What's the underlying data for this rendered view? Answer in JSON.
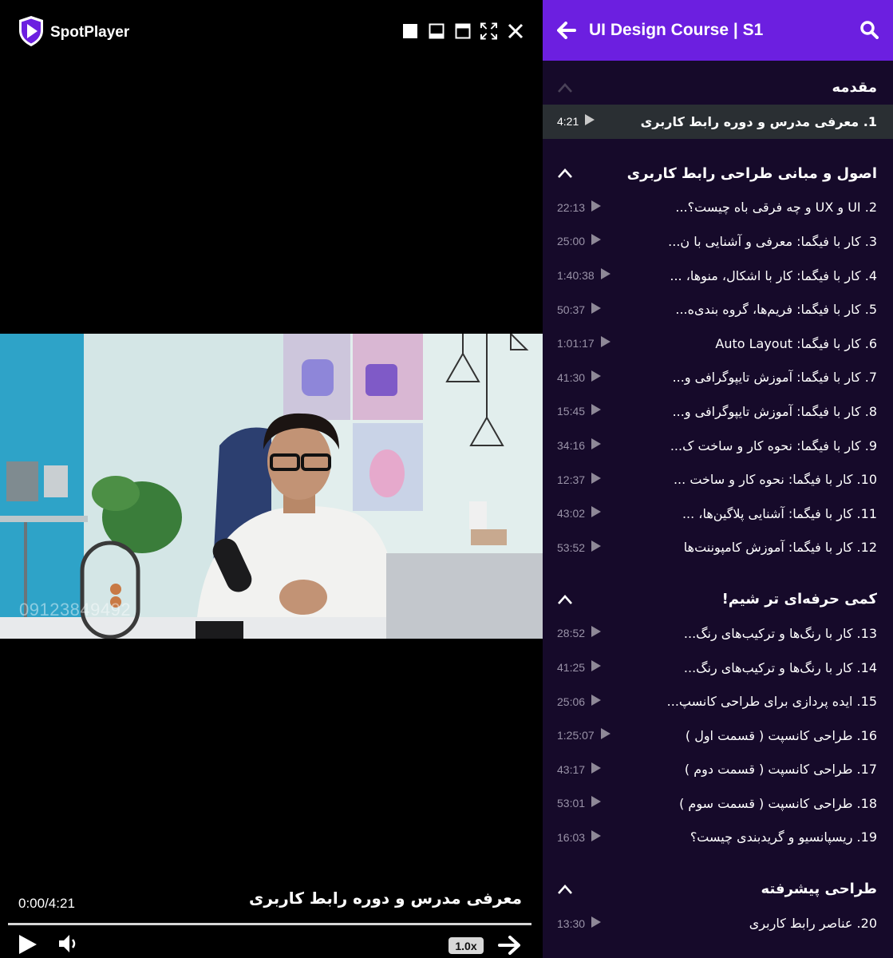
{
  "app": {
    "brand": "SpotPlayer",
    "window_controls": [
      "square-icon",
      "minimize-panel-icon",
      "maximize-icon",
      "fullscreen-icon",
      "close-icon"
    ]
  },
  "video": {
    "watermark": "09123849492",
    "time": "0:00/4:21",
    "title": "معرفی مدرس و دوره رابط کاربری",
    "progress": 0,
    "speed": "1.0x"
  },
  "playlist": {
    "title": "UI Design Course | S1",
    "accent": "#6c1fe0",
    "sections": [
      {
        "title": "مقدمه",
        "expanded": true,
        "lessons": [
          {
            "title": "1. معرفی مدرس و دوره رابط کاربری",
            "duration": "4:21",
            "active": true
          }
        ]
      },
      {
        "title": "اصول و مبانی طراحی رابط کاربری",
        "expanded": true,
        "lessons": [
          {
            "title": "2. UI و UX و چه فرقی باه چیست؟...",
            "duration": "22:13"
          },
          {
            "title": "3. کار با فیگما: معرفی و آشنایی با ن...",
            "duration": "25:00"
          },
          {
            "title": "4. کار با فیگما: کار با اشکال، منوها، ...",
            "duration": "1:40:38"
          },
          {
            "title": "5. کار با فیگما: فریم‌ها، گروه بندی‌ه...",
            "duration": "50:37"
          },
          {
            "title": "6. کار با فیگما: Auto Layout",
            "duration": "1:01:17"
          },
          {
            "title": "7. کار با فیگما: آموزش تایپوگرافی و...",
            "duration": "41:30"
          },
          {
            "title": "8. کار با فیگما: آموزش تایپوگرافی و...",
            "duration": "15:45"
          },
          {
            "title": "9. کار با فیگما: نحوه کار و ساخت ک...",
            "duration": "34:16"
          },
          {
            "title": "10. کار با فیگما: نحوه کار و ساخت ...",
            "duration": "12:37"
          },
          {
            "title": "11. کار با فیگما: آشنایی پلاگین‌ها، ...",
            "duration": "43:02"
          },
          {
            "title": "12. کار با فیگما: آموزش کامپوننت‌ها",
            "duration": "53:52"
          }
        ]
      },
      {
        "title": "کمی حرفه‌ای تر شیم!",
        "expanded": true,
        "lessons": [
          {
            "title": "13. کار با رنگ‌ها و ترکیب‌های رنگ...",
            "duration": "28:52"
          },
          {
            "title": "14. کار با رنگ‌ها و ترکیب‌های رنگ...",
            "duration": "41:25"
          },
          {
            "title": "15. ایده پردازی برای طراحی کانسپ...",
            "duration": "25:06"
          },
          {
            "title": "16. طراحی کانسپت ( قسمت اول )",
            "duration": "1:25:07"
          },
          {
            "title": "17. طراحی کانسپت ( قسمت دوم )",
            "duration": "43:17"
          },
          {
            "title": "18. طراحی کانسپت ( قسمت سوم )",
            "duration": "53:01"
          },
          {
            "title": "19. ریسپانسیو و گریدبندی چیست؟",
            "duration": "16:03"
          }
        ]
      },
      {
        "title": "طراحی پیشرفته",
        "expanded": true,
        "lessons": [
          {
            "title": "20. عناصر رابط کاربری",
            "duration": "13:30"
          }
        ]
      }
    ]
  }
}
